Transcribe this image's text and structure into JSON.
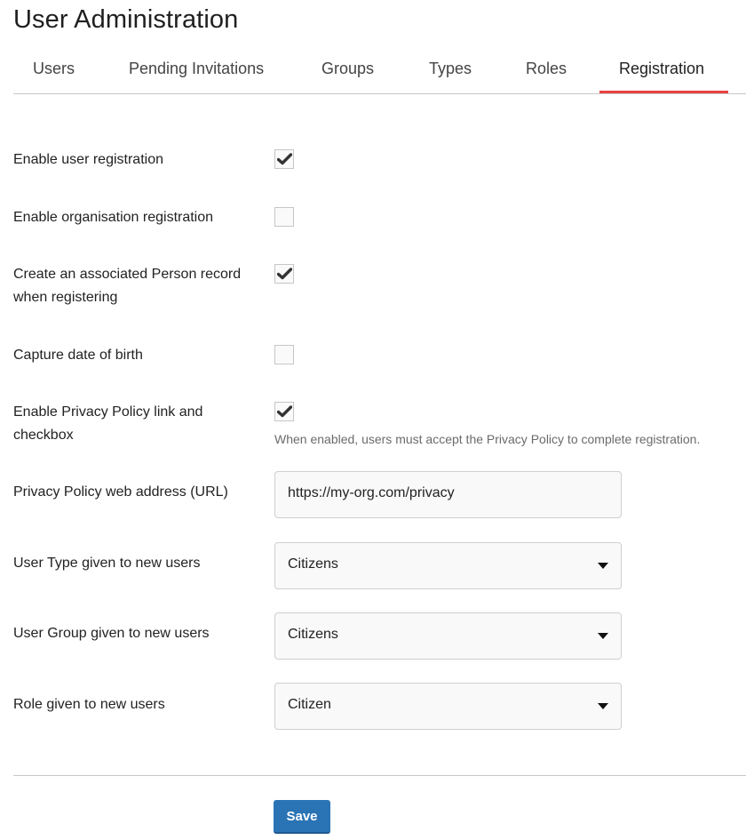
{
  "header": {
    "title": "User Administration"
  },
  "tabs": [
    {
      "label": "Users",
      "active": false
    },
    {
      "label": "Pending Invitations",
      "active": false
    },
    {
      "label": "Groups",
      "active": false
    },
    {
      "label": "Types",
      "active": false
    },
    {
      "label": "Roles",
      "active": false
    },
    {
      "label": "Registration",
      "active": true
    }
  ],
  "accent_color": "#e8423f",
  "form": {
    "enable_user_registration": {
      "label": "Enable user registration",
      "checked": true
    },
    "enable_organisation_registration": {
      "label": "Enable organisation registration",
      "checked": false
    },
    "create_person_record": {
      "label": "Create an associated Person record when registering",
      "checked": true
    },
    "capture_dob": {
      "label": "Capture date of birth",
      "checked": false
    },
    "privacy_policy": {
      "label": "Enable Privacy Policy link and checkbox",
      "checked": true,
      "help": "When enabled, users must accept the Privacy Policy to complete registration."
    },
    "privacy_url": {
      "label": "Privacy Policy web address (URL)",
      "value": "https://my-org.com/privacy"
    },
    "user_type": {
      "label": "User Type given to new users",
      "selected": "Citizens"
    },
    "user_group": {
      "label": "User Group given to new users",
      "selected": "Citizens"
    },
    "role": {
      "label": "Role given to new users",
      "selected": "Citizen"
    }
  },
  "actions": {
    "save_label": "Save",
    "save_color": "#2a74b5"
  }
}
